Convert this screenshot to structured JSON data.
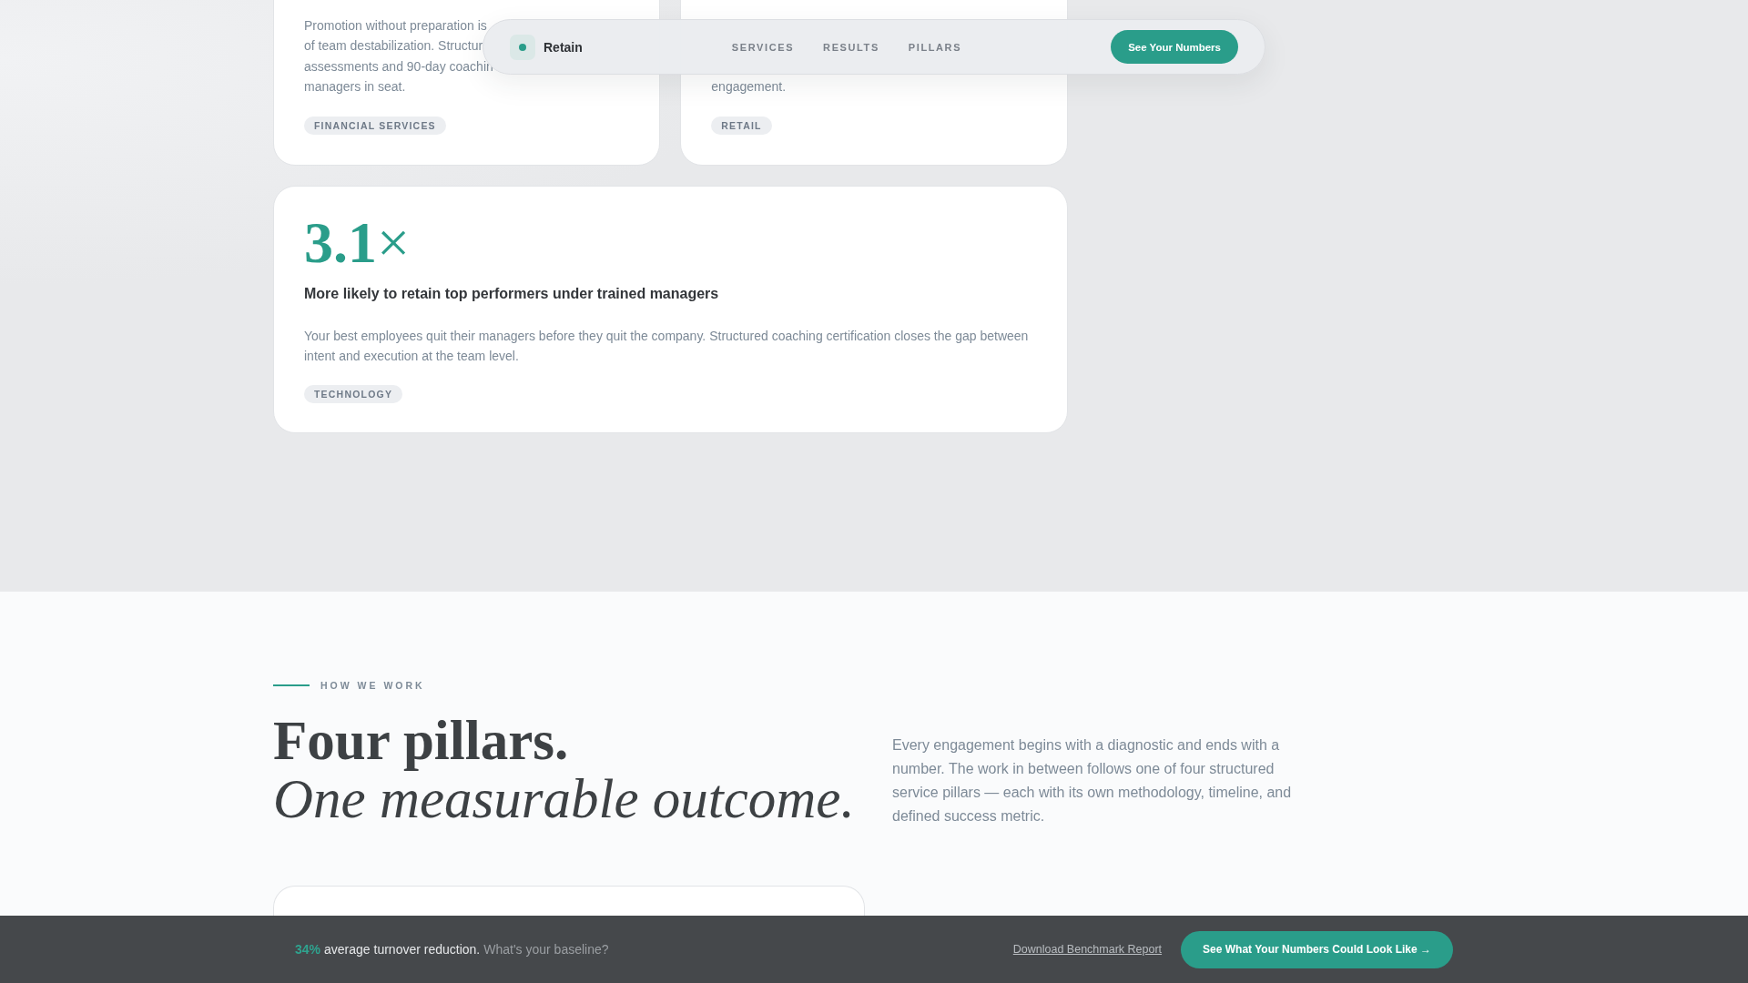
{
  "nav": {
    "brand": "Retain",
    "links": [
      {
        "label": "SERVICES"
      },
      {
        "label": "RESULTS"
      },
      {
        "label": "PILLARS"
      }
    ],
    "cta": "See Your Numbers"
  },
  "result_cards": [
    {
      "wide": false,
      "body": "Promotion without preparation is\nof team destabilization. Structur\nassessments and 90-day coachin\nmanagers in seat.",
      "tag": "FINANCIAL SERVICES"
    },
    {
      "wide": false,
      "body": "engagement.",
      "tag": "RETAIL"
    },
    {
      "wide": true,
      "stat": "**3.1**×",
      "heading": "More likely to retain top performers under trained managers",
      "body": "Your best employees quit their managers before they quit the company. Structured coaching certification closes the gap between intent and execution at the team level.",
      "tag": "TECHNOLOGY"
    }
  ],
  "how_we_work": {
    "eyebrow": "HOW WE WORK",
    "title": "Four pillars.",
    "subtitle": "One measurable outcome.",
    "intro": "Every engagement begins with a diagnostic and ends with a number. The work in between follows one of four structured service pillars — each with its own methodology, timeline, and defined success metric."
  },
  "cta_bar": {
    "stat": "34%",
    "message": "average turnover reduction.",
    "question": "What's your baseline?",
    "link": "Download Benchmark Report",
    "button": "See What Your Numbers Could Look Like →"
  }
}
